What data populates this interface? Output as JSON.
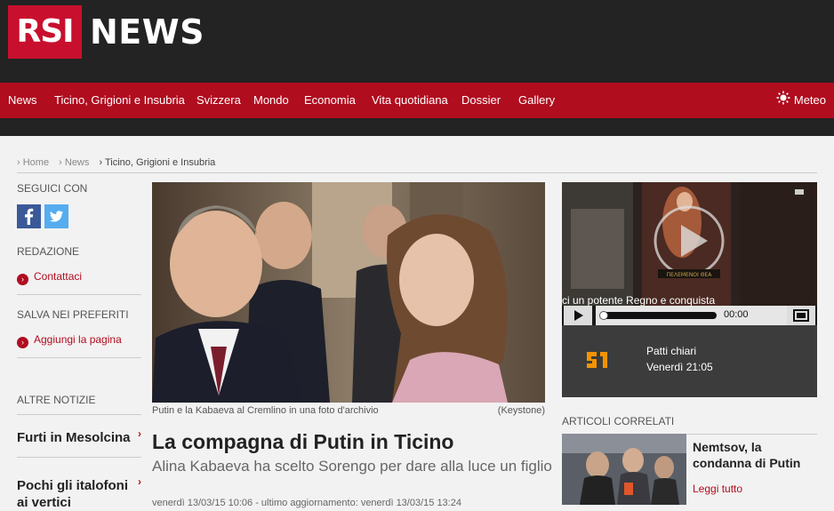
{
  "header": {
    "logo_rsi": "RSI",
    "logo_news": "NEWS"
  },
  "nav": {
    "items": [
      "News",
      "Ticino, Grigioni e Insubria",
      "Svizzera",
      "Mondo",
      "Economia",
      "Vita quotidiana",
      "Dossier",
      "Gallery"
    ],
    "meteo": "Meteo"
  },
  "breadcrumb": [
    "Home",
    "News",
    "Ticino, Grigioni e Insubria"
  ],
  "sidebar": {
    "follow_label": "SEGUICI CON",
    "redazione_label": "REDAZIONE",
    "contact_link": "Contattaci",
    "favorites_label": "SALVA NEI PREFERITI",
    "add_page_link": "Aggiungi la pagina",
    "more_news_label": "ALTRE NOTIZIE",
    "news_items": [
      "Furti in Mesolcina",
      "Pochi gli italofoni ai vertici"
    ]
  },
  "article": {
    "caption": "Putin e la Kabaeva al Cremlino in una foto d'archivio",
    "credit": "(Keystone)",
    "headline": "La compagna di Putin in Ticino",
    "subhead": "Alina Kabaeva ha scelto Sorengo per dare alla luce un figlio",
    "dateline": "venerdì 13/03/15 10:06 - ultimo aggiornamento: venerdì 13/03/15 13:24"
  },
  "video": {
    "overlay_text": "ci un potente Regno e conquista",
    "game_logo": "ΠΕΛΕΜΕΝΟΙ ΘΕΑ",
    "time": "00:00",
    "channel_logo": "LA 1",
    "program": "Patti chiari",
    "schedule": "Venerdì 21:05"
  },
  "related": {
    "heading": "ARTICOLI CORRELATI",
    "title": "Nemtsov, la condanna di Putin",
    "more": "Leggi tutto"
  },
  "colors": {
    "brand_red": "#b00d1f",
    "logo_red": "#c8102e",
    "dark": "#232323"
  }
}
